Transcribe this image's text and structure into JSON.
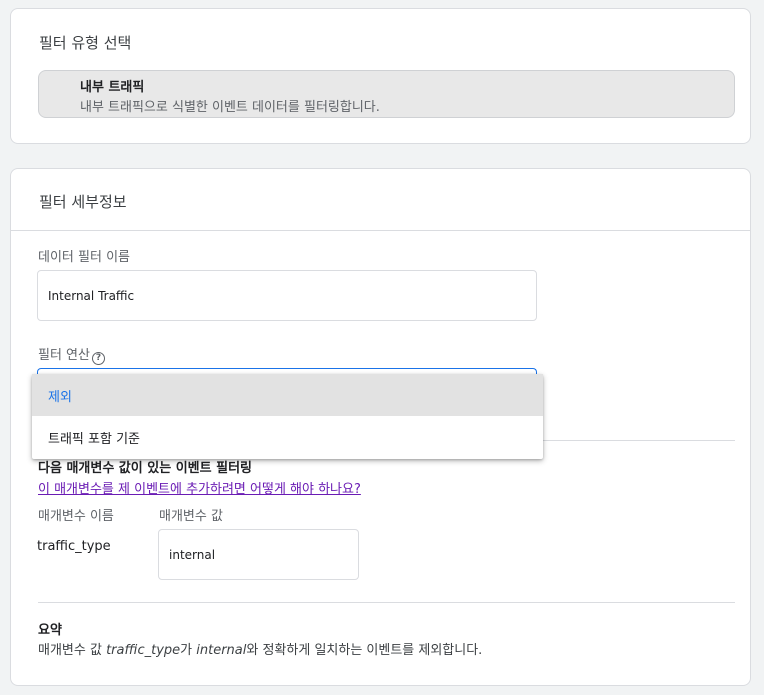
{
  "filter_type": {
    "title": "필터 유형 선택",
    "option_name": "내부 트래픽",
    "option_desc": "내부 트래픽으로 식별한 이벤트 데이터를 필터링합니다."
  },
  "filter_details": {
    "title": "필터 세부정보",
    "name_label": "데이터 필터 이름",
    "name_value": "Internal Traffic",
    "operation_label": "필터 연산",
    "help_icon": "?",
    "operation_options": [
      "제외",
      "트래픽 포함 기준"
    ],
    "params_heading": "다음 매개변수 값이 있는 이벤트 필터링",
    "params_link": "이 매개변수를 제 이벤트에 추가하려면 어떻게 해야 하나요?",
    "param_name_label": "매개변수 이름",
    "param_value_label": "매개변수 값",
    "param_name": "traffic_type",
    "param_value": "internal",
    "summary_heading": "요약",
    "summary_prefix": "매개변수 값 ",
    "summary_param": "traffic_type",
    "summary_mid1": "가 ",
    "summary_value": "internal",
    "summary_suffix": "와 정확하게 일치하는 이벤트를 제외합니다."
  },
  "colors": {
    "accent": "#1a73e8",
    "link": "#6a1bb4",
    "selected_bg": "#e2e2e2"
  }
}
